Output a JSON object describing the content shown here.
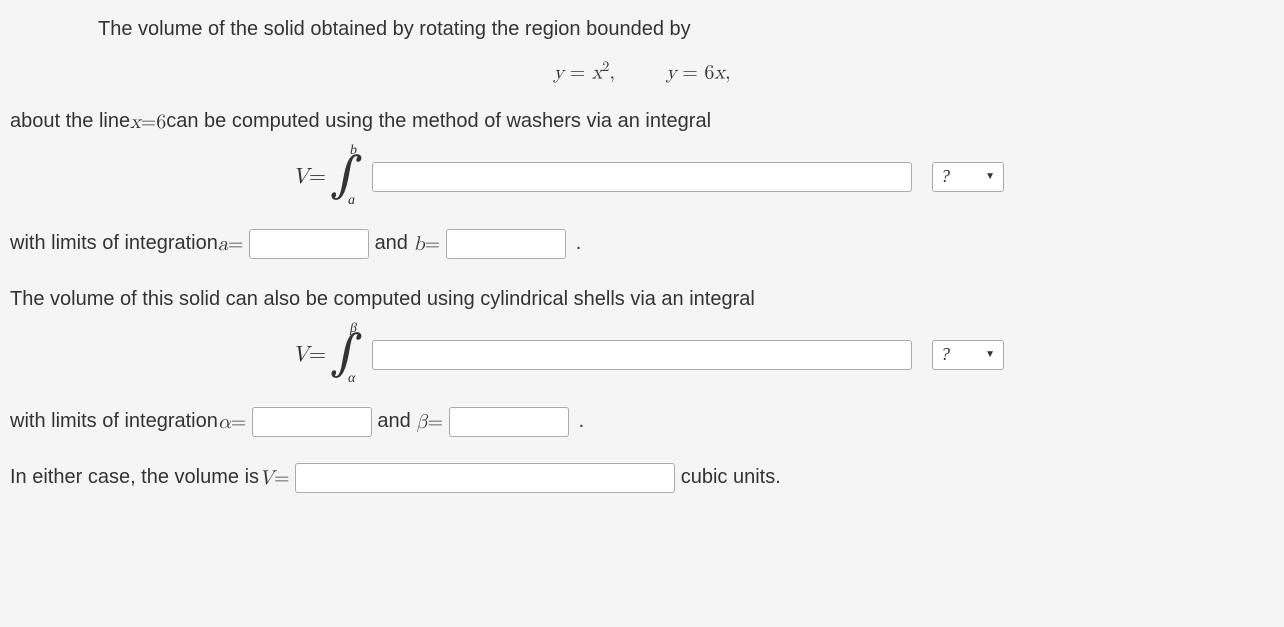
{
  "intro_indent": "The volume of the solid obtained by rotating the region bounded by",
  "equations_center": {
    "eq1_y": "y",
    "eq1_eq": " = ",
    "eq1_rhs_x": "x",
    "eq1_exp": "2",
    "eq1_comma": ",",
    "eq2_y": "y",
    "eq2_eq": " = ",
    "eq2_rhs": "6",
    "eq2_x": "x",
    "eq2_comma": ","
  },
  "line_about": {
    "p1": "about the line ",
    "xvar": "x",
    "eq": " = ",
    "six": "6",
    "p2": " can be computed using the method of washers via an integral"
  },
  "washer": {
    "V": "V",
    "eq": " = ",
    "int_up": "b",
    "int_lo": "a",
    "hint": "?"
  },
  "limits1": {
    "p1": "with limits of integration ",
    "a": "a",
    "eq1": " = ",
    "and": " and ",
    "b": "b",
    "eq2": " = "
  },
  "shells_intro": "The volume of this solid can also be computed using cylindrical shells via an integral",
  "shells": {
    "V": "V",
    "eq": " = ",
    "int_up": "β",
    "int_lo": "α",
    "hint": "?"
  },
  "limits2": {
    "p1": "with limits of integration ",
    "a": "α",
    "eq1": " = ",
    "and": " and ",
    "b": "β",
    "eq2": " = "
  },
  "final": {
    "p1": "In either case, the volume is ",
    "V": "V",
    "eq": " = ",
    "units": " cubic units."
  }
}
